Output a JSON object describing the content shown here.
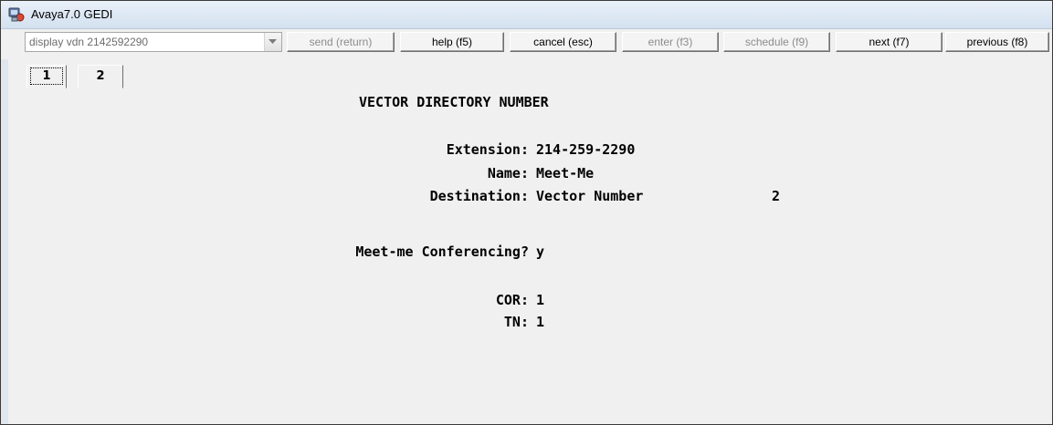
{
  "window": {
    "title": "Avaya7.0 GEDI"
  },
  "toolbar": {
    "command": "display vdn 2142592290",
    "send": "send (return)",
    "help": "help (f5)",
    "cancel": "cancel (esc)",
    "enter": "enter (f3)",
    "schedule": "schedule (f9)",
    "next": "next (f7)",
    "previous": "previous (f8)"
  },
  "tabs": [
    "1",
    "2"
  ],
  "form": {
    "heading": "VECTOR DIRECTORY NUMBER",
    "extension_label": "Extension:",
    "extension_value": "214-259-2290",
    "name_label": "Name:",
    "name_value": "Meet-Me",
    "destination_label": "Destination:",
    "destination_type": "Vector Number",
    "destination_number": "2",
    "meetme_label": "Meet-me Conferencing?",
    "meetme_value": "y",
    "cor_label": "COR:",
    "cor_value": "1",
    "tn_label": "TN:",
    "tn_value": "1"
  },
  "icons": {
    "app": "avaya-gedi-icon",
    "dropdown": "chevron-down-icon"
  }
}
